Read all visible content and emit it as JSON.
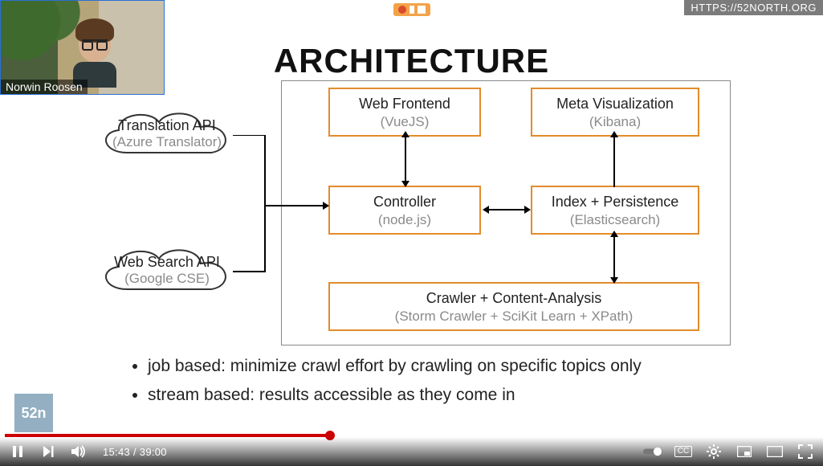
{
  "header": {
    "url_badge": "HTTPS://52NORTH.ORG",
    "title": "ARCHITECTURE"
  },
  "webcam": {
    "name": "Norwin Roosen"
  },
  "diagram": {
    "boxes": {
      "frontend": {
        "title": "Web Frontend",
        "subtitle": "(VueJS)"
      },
      "meta": {
        "title": "Meta Visualization",
        "subtitle": "(Kibana)"
      },
      "controller": {
        "title": "Controller",
        "subtitle": "(node.js)"
      },
      "index": {
        "title": "Index + Persistence",
        "subtitle": "(Elasticsearch)"
      },
      "crawler": {
        "title": "Crawler + Content-Analysis",
        "subtitle": "(Storm Crawler + SciKit Learn + XPath)"
      }
    },
    "clouds": {
      "translate": {
        "title": "Translation API",
        "subtitle": "(Azure Translator)"
      },
      "search": {
        "title": "Web Search API",
        "subtitle": "(Google CSE)"
      }
    }
  },
  "bullets": {
    "items": [
      "job based: minimize crawl effort by crawling on specific topics only",
      "stream based: results accessible as they come in"
    ]
  },
  "corner_logo": "52n",
  "player": {
    "current_time": "15:43",
    "separator": " / ",
    "duration": "39:00",
    "progress_pct": 40,
    "buffer_start_pct": 40,
    "buffer_end_pct": 48,
    "cc_label": "CC",
    "colors": {
      "progress": "#cc0000"
    }
  }
}
